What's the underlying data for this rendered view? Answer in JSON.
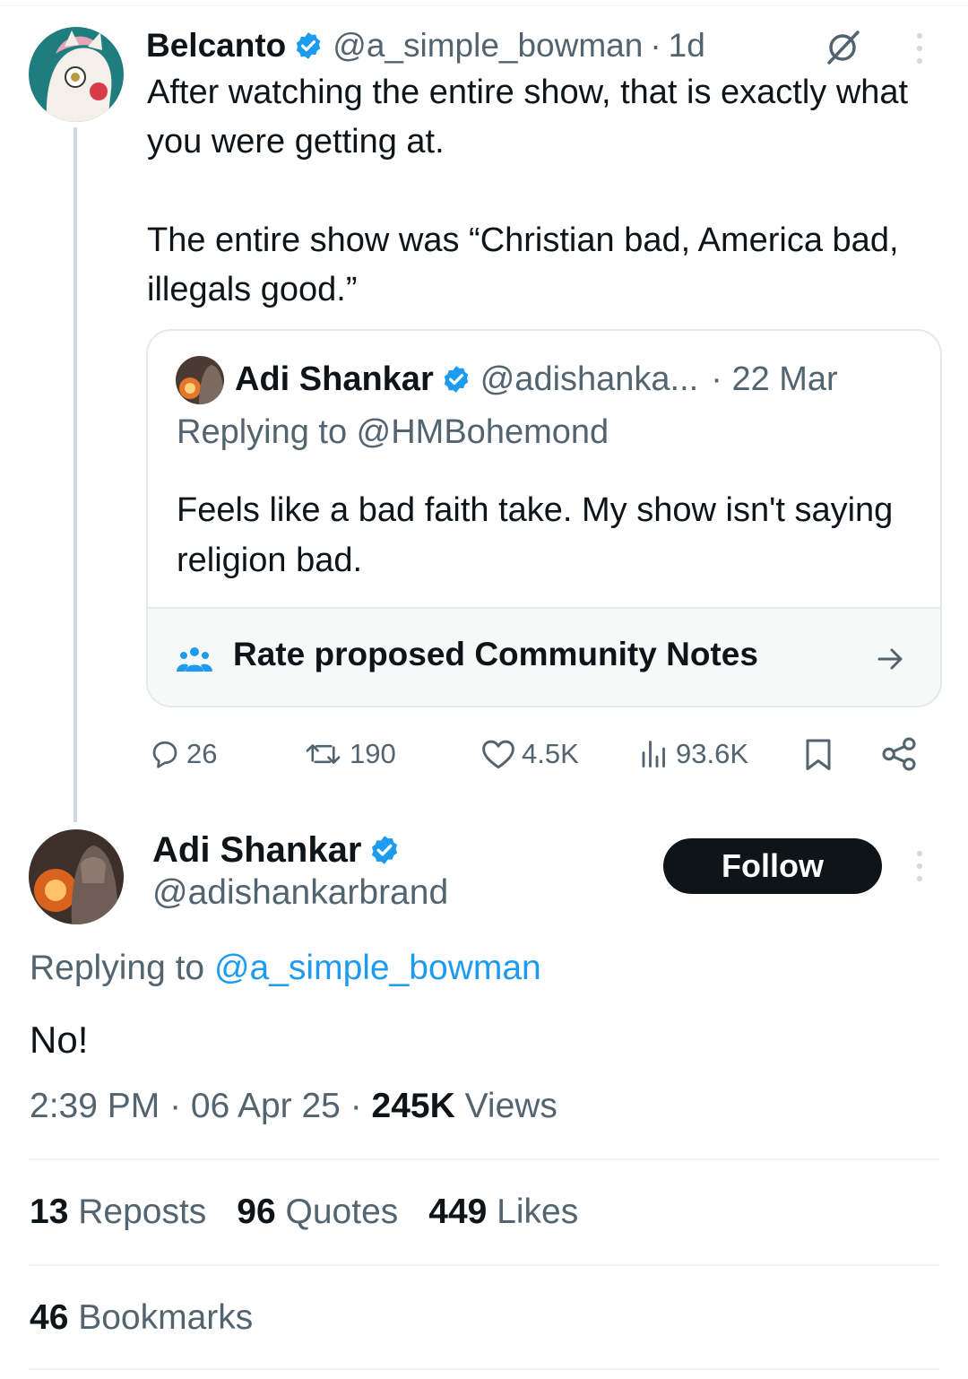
{
  "parent": {
    "name": "Belcanto",
    "handle": "@a_simple_bowman",
    "sep": "·",
    "time": "1d",
    "text": "After watching the entire show, that is exactly what you were getting at.\n\nThe entire show was “Christian bad, America bad, illegals good.”",
    "actions": {
      "replies": "26",
      "reposts": "190",
      "likes": "4.5K",
      "views": "93.6K"
    }
  },
  "quoted": {
    "name": "Adi Shankar",
    "handle": "@adishanka...",
    "date": "· 22 Mar",
    "replying_label": "Replying to @HMBohemond",
    "text": "Feels like a bad faith take. My show isn't saying religion bad.",
    "community_notes": "Rate proposed Community Notes"
  },
  "main": {
    "name": "Adi Shankar",
    "handle": "@adishankarbrand",
    "follow_label": "Follow",
    "replying_prefix": "Replying to ",
    "replying_handle": "@a_simple_bowman",
    "text": "No!",
    "time": "2:39 PM · 06 Apr 25 · ",
    "views_count": "245K",
    "views_label": " Views",
    "stats": {
      "reposts_count": "13",
      "reposts_label": " Reposts",
      "quotes_count": "96",
      "quotes_label": " Quotes",
      "likes_count": "449",
      "likes_label": " Likes",
      "bookmarks_count": "46",
      "bookmarks_label": " Bookmarks"
    }
  },
  "colors": {
    "verified": "#1d9bf0",
    "link": "#1d9bf0",
    "muted": "#536471",
    "text": "#0f1419"
  }
}
